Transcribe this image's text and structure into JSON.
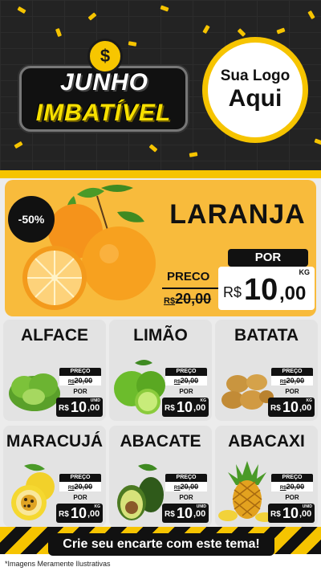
{
  "header": {
    "title_line1": "JUNHO",
    "title_line2": "IMBATÍVEL",
    "coin_symbol": "$",
    "logo_line1": "Sua Logo",
    "logo_line2": "Aqui"
  },
  "featured": {
    "discount": "-50%",
    "name": "LARANJA",
    "preco_label": "PRECO",
    "old_currency": "R$",
    "old_price": "20,00",
    "por_label": "POR",
    "currency": "R$",
    "price_int": "10",
    "price_dec": ",00",
    "unit": "KG"
  },
  "products": [
    {
      "name": "ALFACE",
      "preco_label": "PREÇO",
      "old_currency": "R$",
      "old_price": "20,00",
      "por_label": "POR",
      "currency": "R$",
      "price_int": "10",
      "price_dec": ",00",
      "unit": "UNID"
    },
    {
      "name": "LIMÃO",
      "preco_label": "PREÇO",
      "old_currency": "R$",
      "old_price": "20,00",
      "por_label": "POR",
      "currency": "R$",
      "price_int": "10",
      "price_dec": ",00",
      "unit": "KG"
    },
    {
      "name": "BATATA",
      "preco_label": "PREÇO",
      "old_currency": "R$",
      "old_price": "20,00",
      "por_label": "POR",
      "currency": "R$",
      "price_int": "10",
      "price_dec": ",00",
      "unit": "KG"
    },
    {
      "name": "MARACUJÁ",
      "preco_label": "PREÇO",
      "old_currency": "R$",
      "old_price": "20,00",
      "por_label": "POR",
      "currency": "R$",
      "price_int": "10",
      "price_dec": ",00",
      "unit": "KG"
    },
    {
      "name": "ABACATE",
      "preco_label": "PREÇO",
      "old_currency": "R$",
      "old_price": "20,00",
      "por_label": "POR",
      "currency": "R$",
      "price_int": "10",
      "price_dec": ",00",
      "unit": "UNID"
    },
    {
      "name": "ABACAXI",
      "preco_label": "PREÇO",
      "old_currency": "R$",
      "old_price": "20,00",
      "por_label": "POR",
      "currency": "R$",
      "price_int": "10",
      "price_dec": ",00",
      "unit": "UNID"
    }
  ],
  "footer": {
    "cta": "Crie seu encarte com este tema!",
    "disclaimer": "*Imagens Meramente Ilustrativas"
  },
  "colors": {
    "accent": "#f6c400",
    "orange_panel": "#f8bb3c",
    "dark": "#111111",
    "card": "#e3e3e3"
  },
  "icons": [
    "dollar-coin-icon",
    "orange-image",
    "lettuce-image",
    "lime-image",
    "potato-image",
    "passion-fruit-image",
    "avocado-image",
    "pineapple-image"
  ]
}
